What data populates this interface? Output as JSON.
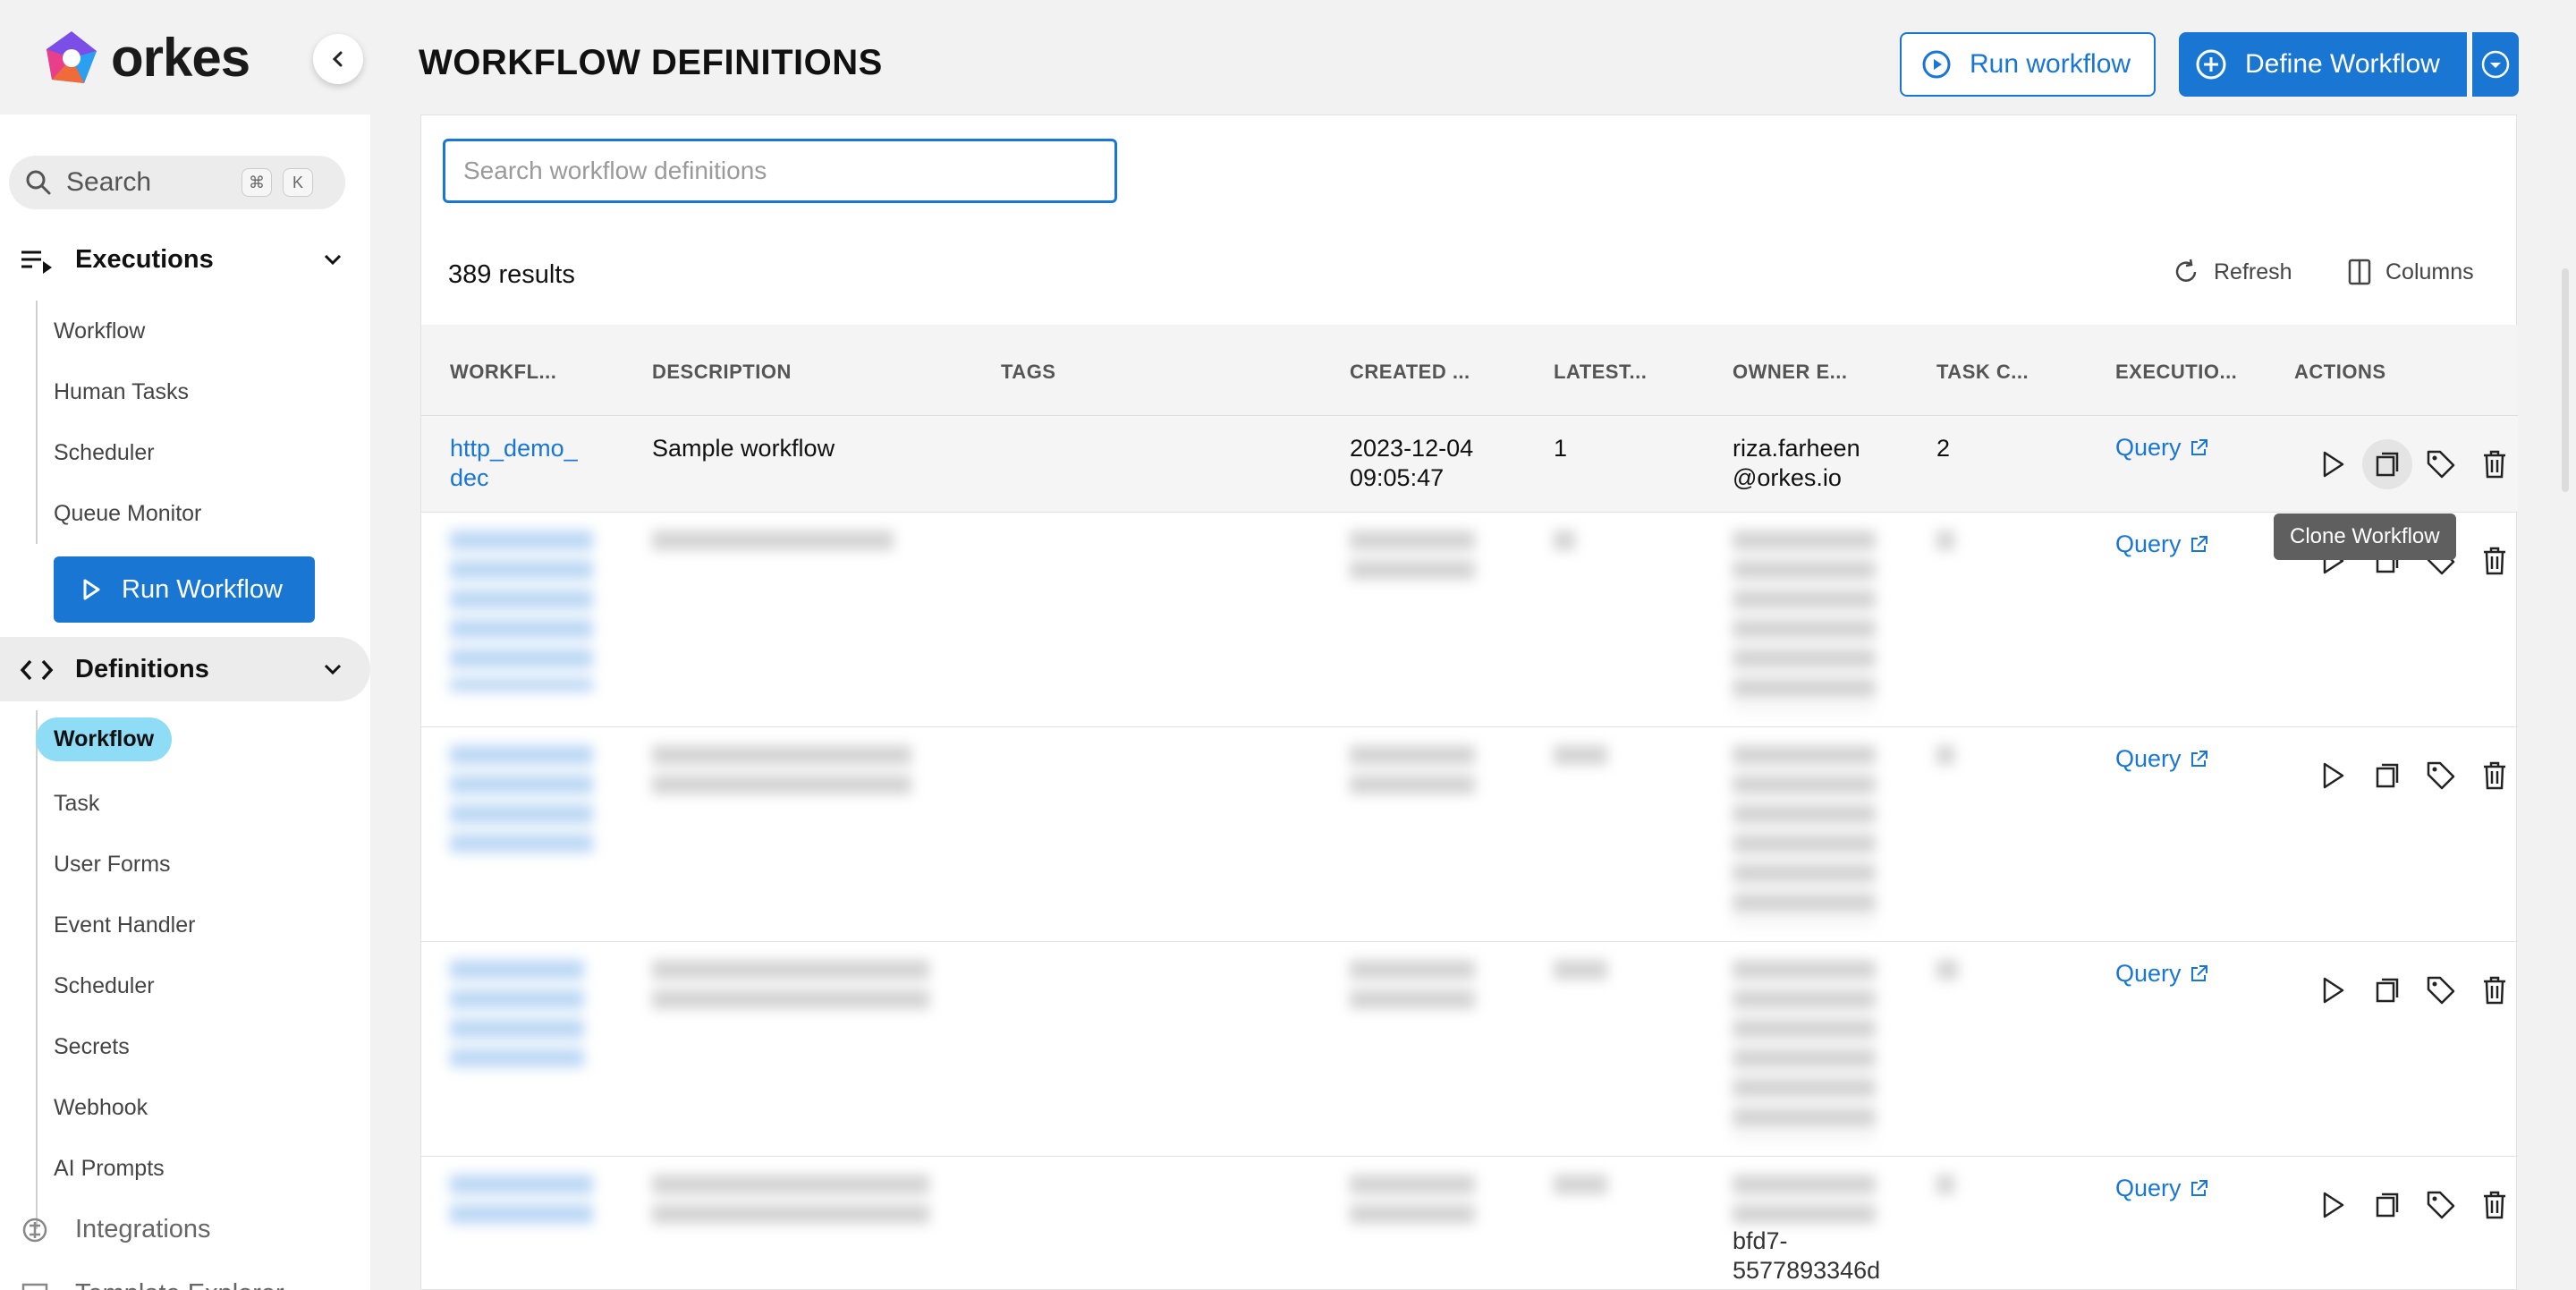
{
  "app": {
    "logo_text": "orkes",
    "brand_color": "#1976d2"
  },
  "sidebar": {
    "search": {
      "label": "Search",
      "kbd_cmd": "⌘",
      "kbd_key": "K"
    },
    "executions": {
      "label": "Executions",
      "items": [
        {
          "label": "Workflow"
        },
        {
          "label": "Human Tasks"
        },
        {
          "label": "Scheduler"
        },
        {
          "label": "Queue Monitor"
        }
      ]
    },
    "run_workflow_label": "Run Workflow",
    "definitions": {
      "label": "Definitions",
      "items": [
        {
          "label": "Workflow",
          "active": true
        },
        {
          "label": "Task"
        },
        {
          "label": "User Forms"
        },
        {
          "label": "Event Handler"
        },
        {
          "label": "Scheduler"
        },
        {
          "label": "Secrets"
        },
        {
          "label": "Webhook"
        },
        {
          "label": "AI Prompts"
        }
      ]
    },
    "integrations_label": "Integrations",
    "template_explorer_label": "Template Explorer"
  },
  "header": {
    "title": "WORKFLOW DEFINITIONS",
    "run_workflow_label": "Run workflow",
    "define_workflow_label": "Define Workflow"
  },
  "search": {
    "placeholder": "Search workflow definitions",
    "value": ""
  },
  "results": {
    "count_text": "389 results",
    "refresh_label": "Refresh",
    "columns_label": "Columns"
  },
  "table": {
    "columns": [
      "WORKFL...",
      "DESCRIPTION",
      "TAGS",
      "CREATED ...",
      "LATEST...",
      "OWNER E...",
      "TASK C...",
      "EXECUTIO...",
      "ACTIONS"
    ],
    "rows": [
      {
        "name_l1": "http_demo_",
        "name_l2": "dec",
        "description": "Sample workflow",
        "created_l1": "2023-12-04",
        "created_l2": "09:05:47",
        "latest": "1",
        "owner_l1": "riza.farheen",
        "owner_l2": "@orkes.io",
        "task_count": "2",
        "execution": "Query"
      },
      {
        "execution": "Query",
        "owner_partial_l1": "bfd7-",
        "owner_partial_l2": "5577893346d"
      }
    ]
  },
  "tooltip": {
    "text": "Clone Workflow"
  }
}
